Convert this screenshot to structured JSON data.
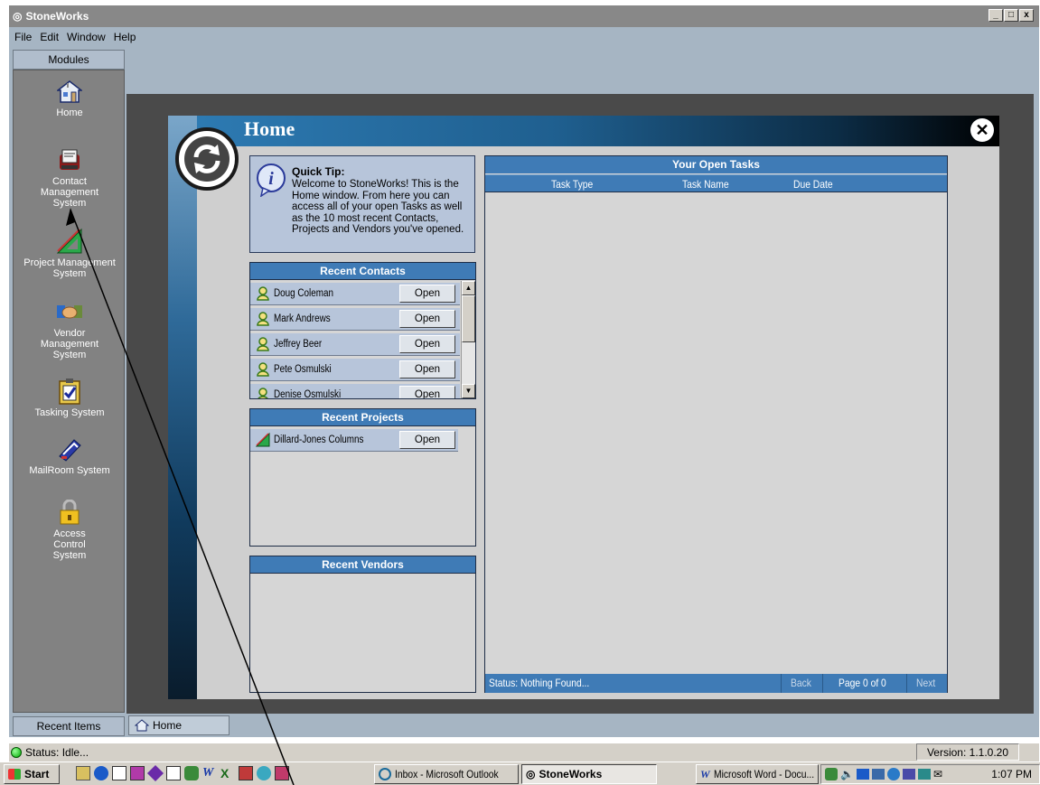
{
  "window": {
    "title": "StoneWorks",
    "btn_min": "_",
    "btn_max": "□",
    "btn_close": "x"
  },
  "menu": [
    "File",
    "Edit",
    "Window",
    "Help"
  ],
  "sidebar": {
    "header": "Modules",
    "items": [
      {
        "label": "Home",
        "icon": "house-icon"
      },
      {
        "label": "Contact Management System",
        "icon": "rolodex-icon"
      },
      {
        "label": "Project Management System",
        "icon": "triangle-ruler-icon"
      },
      {
        "label": "Vendor Management System",
        "icon": "handshake-icon"
      },
      {
        "label": "Tasking System",
        "icon": "clipboard-check-icon"
      },
      {
        "label": "MailRoom System",
        "icon": "envelope-icon"
      },
      {
        "label": "Access Control System",
        "icon": "padlock-icon"
      }
    ],
    "footer": "Recent Items"
  },
  "open_tab": "Home",
  "status": {
    "text": "Status: Idle...",
    "version": "Version: 1.1.0.20"
  },
  "home": {
    "title": "Home",
    "quick_tip": {
      "title": "Quick Tip:",
      "text": "Welcome to StoneWorks! This is the Home window. From here you can access all of your open Tasks as well as the 10 most recent Contacts, Projects and Vendors you've opened."
    },
    "recent_contacts": {
      "header": "Recent Contacts",
      "items": [
        {
          "name": "Doug Coleman",
          "action": "Open"
        },
        {
          "name": "Mark Andrews",
          "action": "Open"
        },
        {
          "name": "Jeffrey Beer",
          "action": "Open"
        },
        {
          "name": "Pete Osmulski",
          "action": "Open"
        },
        {
          "name": "Denise Osmulski",
          "action": "Open"
        }
      ]
    },
    "recent_projects": {
      "header": "Recent Projects",
      "items": [
        {
          "name": "Dillard-Jones Columns",
          "action": "Open"
        }
      ]
    },
    "recent_vendors": {
      "header": "Recent Vendors",
      "items": []
    },
    "tasks": {
      "header": "Your Open Tasks",
      "columns": [
        "Task Type",
        "Task Name",
        "Due Date"
      ],
      "status": "Status: Nothing Found...",
      "back": "Back",
      "page": "Page 0 of 0",
      "next": "Next"
    }
  },
  "taskbar": {
    "start": "Start",
    "buttons": [
      "Inbox - Microsoft Outlook",
      "StoneWorks",
      "Microsoft Word - Docu..."
    ],
    "clock": "1:07 PM"
  },
  "colors": {
    "panel_header": "#3f7bb6",
    "row": "#b7c5da",
    "app_bg": "#a6b5c3"
  }
}
